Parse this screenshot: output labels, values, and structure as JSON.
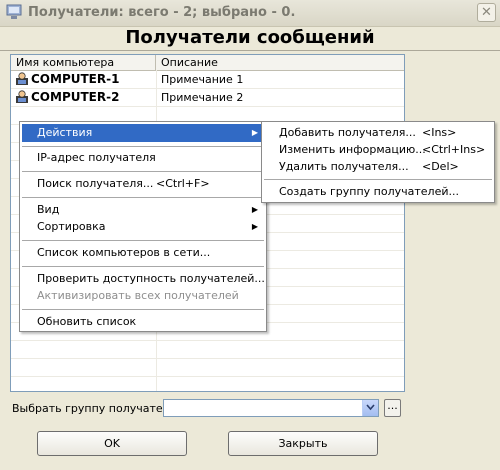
{
  "window": {
    "title": "Получатели: всего - 2; выбрано - 0.",
    "close_glyph": "✕"
  },
  "heading": "Получатели сообщений",
  "list": {
    "columns": [
      "Имя компьютера",
      "Описание"
    ],
    "rows": [
      {
        "name": "COMPUTER-1",
        "description": "Примечание 1"
      },
      {
        "name": "COMPUTER-2",
        "description": "Примечание 2"
      }
    ]
  },
  "context_menu": {
    "items": [
      {
        "label": "Действия",
        "submenu": true,
        "selected": true
      },
      {
        "label": "IP-адрес получателя"
      },
      {
        "label": "Поиск получателя...",
        "shortcut": "<Ctrl+F>"
      },
      {
        "label": "Вид",
        "submenu": true
      },
      {
        "label": "Сортировка",
        "submenu": true
      },
      {
        "label": "Список компьютеров в сети..."
      },
      {
        "label": "Проверить доступность получателей..."
      },
      {
        "label": "Активизировать всех получателей",
        "disabled": true
      },
      {
        "label": "Обновить список"
      }
    ]
  },
  "submenu": {
    "items": [
      {
        "label": "Добавить получателя...",
        "shortcut": "<Ins>"
      },
      {
        "label": "Изменить информацию...",
        "shortcut": "<Ctrl+Ins>"
      },
      {
        "label": "Удалить получателя...",
        "shortcut": "<Del>"
      },
      {
        "label": "Создать группу получателей..."
      }
    ]
  },
  "group": {
    "label": "Выбрать группу получателей:",
    "value": "",
    "browse_label": "..."
  },
  "buttons": {
    "ok": "OK",
    "close": "Закрыть"
  },
  "colors": {
    "selection": "#316ac5",
    "dialog_bg": "#ece9d8"
  }
}
